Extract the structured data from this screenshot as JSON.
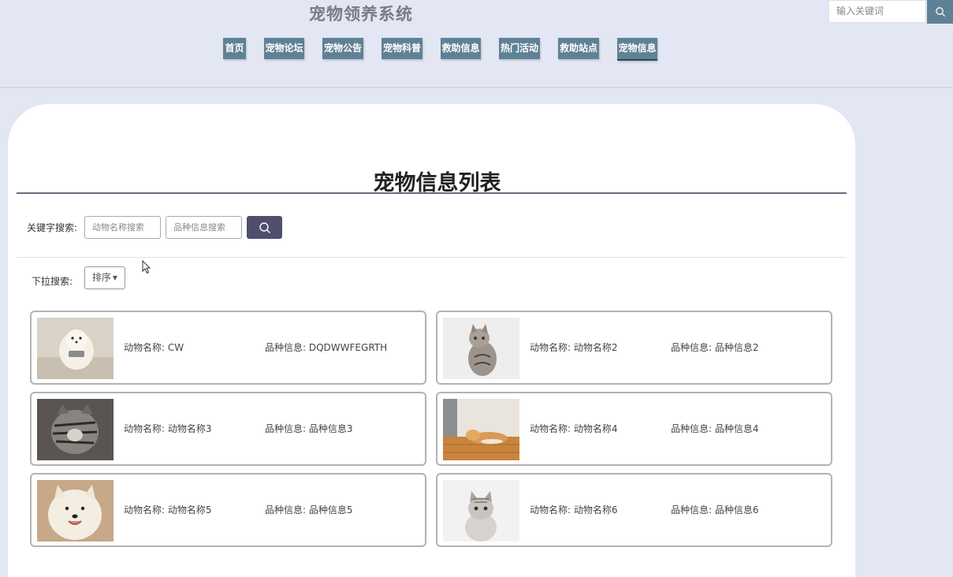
{
  "header": {
    "site_title": "宠物领养系统",
    "search_placeholder": "输入关键词"
  },
  "nav": {
    "items": [
      {
        "label": "首页"
      },
      {
        "label": "宠物论坛"
      },
      {
        "label": "宠物公告"
      },
      {
        "label": "宠物科普"
      },
      {
        "label": "救助信息"
      },
      {
        "label": "热门活动"
      },
      {
        "label": "救助站点"
      },
      {
        "label": "宠物信息"
      }
    ],
    "active": "宠物信息"
  },
  "main": {
    "title": "宠物信息列表",
    "keyword_label": "关键字搜索:",
    "name_placeholder": "动物名称搜索",
    "breed_placeholder": "品种信息搜索",
    "dropdown_label": "下拉搜索:",
    "sort_label": "排序"
  },
  "pets": [
    {
      "name_label": "动物名称:",
      "name": "CW",
      "breed_label": "品种信息:",
      "breed": "DQDWWFEGRTH"
    },
    {
      "name_label": "动物名称:",
      "name": "动物名称2",
      "breed_label": "品种信息:",
      "breed": "品种信息2"
    },
    {
      "name_label": "动物名称:",
      "name": "动物名称3",
      "breed_label": "品种信息:",
      "breed": "品种信息3"
    },
    {
      "name_label": "动物名称:",
      "name": "动物名称4",
      "breed_label": "品种信息:",
      "breed": "品种信息4"
    },
    {
      "name_label": "动物名称:",
      "name": "动物名称5",
      "breed_label": "品种信息:",
      "breed": "品种信息5"
    },
    {
      "name_label": "动物名称:",
      "name": "动物名称6",
      "breed_label": "品种信息:",
      "breed": "品种信息6"
    }
  ],
  "colors": {
    "page_bg": "#e3e6f3",
    "nav_bg": "#5f8195",
    "search_button": "#4f4f6d"
  }
}
